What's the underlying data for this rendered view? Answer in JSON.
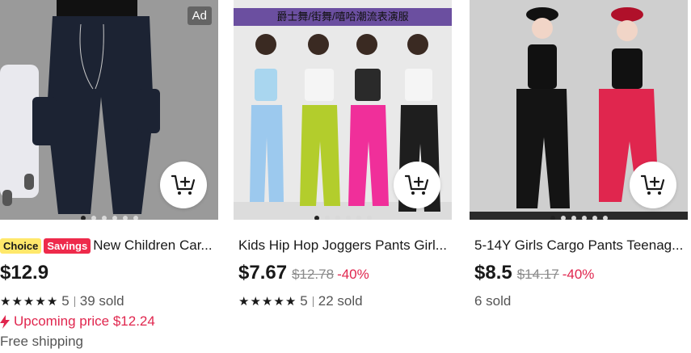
{
  "products": [
    {
      "ad_label": "Ad",
      "tags": {
        "choice": "Choice",
        "savings": "Savings"
      },
      "title": "New Children Car...",
      "price": "$12.9",
      "rating": "5",
      "sold": "39 sold",
      "upcoming_price": "Upcoming price $12.24",
      "shipping": "Free shipping",
      "images_count": 6,
      "active_image": 1
    },
    {
      "banner_text": "爵士舞/街舞/嘻哈潮流表演服",
      "title": "Kids Hip Hop Joggers Pants Girl...",
      "price": "$7.67",
      "old_price": "$12.78",
      "discount": "-40%",
      "rating": "5",
      "sold": "22 sold",
      "images_count": 6,
      "active_image": 1
    },
    {
      "title": "5-14Y Girls Cargo Pants Teenag...",
      "price": "$8.5",
      "old_price": "$14.17",
      "discount": "-40%",
      "sold": "6 sold",
      "images_count": 6,
      "active_image": 1
    }
  ],
  "icons": {
    "cart": "add-to-cart-icon",
    "star": "star-icon",
    "bolt": "lightning-icon"
  },
  "colors": {
    "accent_red": "#e0264e",
    "choice_yellow": "#ffe86b",
    "savings_red": "#ee2a4b"
  }
}
